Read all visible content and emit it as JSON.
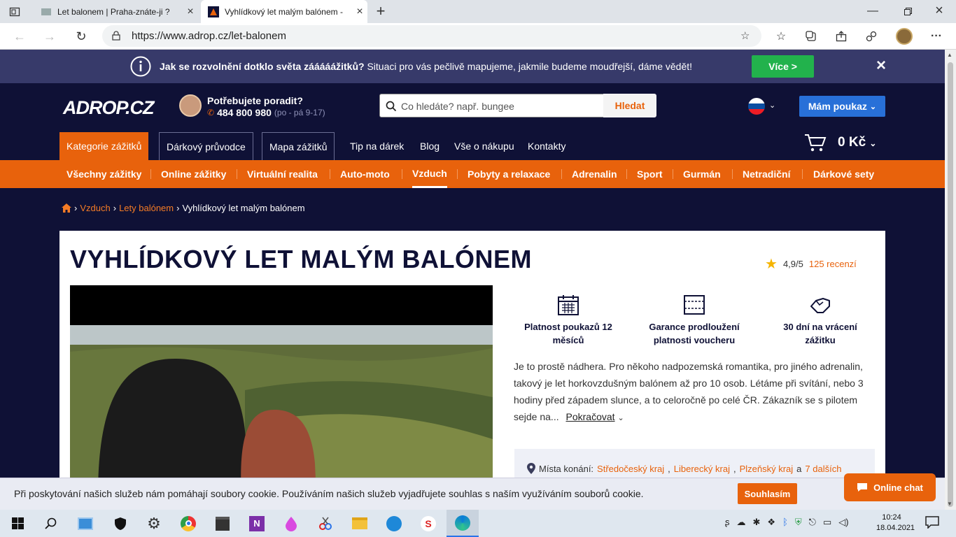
{
  "browser": {
    "tabs": [
      {
        "title": "Let balonem | Praha-znáte-ji ?",
        "active": false
      },
      {
        "title": "Vyhlídkový let malým balónem -",
        "active": true
      }
    ],
    "url": "https://www.adrop.cz/let-balonem"
  },
  "infobar": {
    "bold_text": "Jak se rozvolnění dotklo světa zááááážitků?",
    "text": " Situaci pro vás pečlivě mapujeme, jakmile budeme moudřejší, dáme vědět!",
    "button": "Více >"
  },
  "header": {
    "logo": "ADROP.CZ",
    "help_title": "Potřebujete poradit?",
    "phone": "484 800 980",
    "hours": "(po - pá 9-17)",
    "search_placeholder": "Co hledáte? např. bungee",
    "search_button": "Hledat",
    "voucher_button": "Mám poukaz",
    "cart_total": "0 Kč"
  },
  "main_nav": [
    "Kategorie zážitků",
    "Dárkový průvodce",
    "Mapa zážitků",
    "Tip na dárek",
    "Blog",
    "Vše o nákupu",
    "Kontakty"
  ],
  "category_nav": [
    "Všechny zážitky",
    "Online zážitky",
    "Virtuální realita",
    "Auto-moto",
    "Vzduch",
    "Pobyty a relaxace",
    "Adrenalin",
    "Sport",
    "Gurmán",
    "Netradiční",
    "Dárkové sety"
  ],
  "breadcrumb": [
    "Vzduch",
    "Lety balónem",
    "Vyhlídkový let malým balónem"
  ],
  "product": {
    "title": "VYHLÍDKOVÝ LET MALÝM BALÓNEM",
    "rating": "4,9/5",
    "reviews": "125 recenzí",
    "features": [
      "Platnost poukazů 12 měsíců",
      "Garance prodloužení platnosti voucheru",
      "30 dní na vrácení zážitku"
    ],
    "description": "Je to prostě nádhera. Pro někoho nadpozemská romantika, pro jiného adrenalin, takový je let horkovzdušným balónem až pro 10 osob. Létáme při svítání, nebo 3 hodiny před západem slunce, a to celoročně po celé ČR. Zákazník se s pilotem sejde na...",
    "more": "Pokračovat",
    "places_label": "Místa konání:",
    "places": [
      "Středočeský kraj",
      "Liberecký kraj",
      "Plzeňský kraj"
    ],
    "places_conj": "a",
    "places_more": "7 dalších"
  },
  "cookie": {
    "text": "Při poskytování našich služeb nám pomáhají soubory cookie. Používáním našich služeb vyjadřujete souhlas s naším využíváním souborů cookie.",
    "button": "Souhlasím"
  },
  "chat": {
    "label": "Online chat"
  },
  "taskbar": {
    "time": "10:24",
    "date": "18.04.2021"
  }
}
